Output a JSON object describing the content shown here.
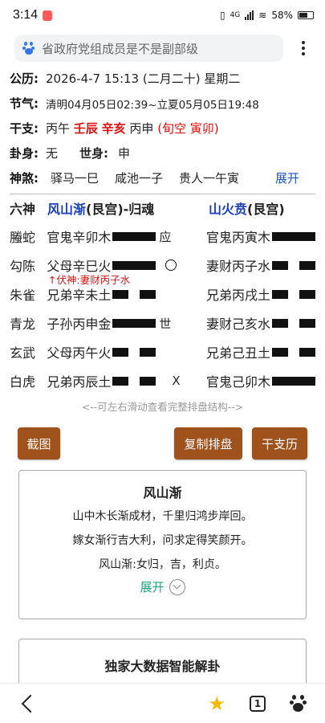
{
  "status": {
    "time": "3:14",
    "signal_label": "4G",
    "battery": "58%"
  },
  "search": {
    "query": "省政府党组成员是不是副部级"
  },
  "info": {
    "gongli_label": "公历:",
    "gongli_value": "2026-4-7 15:13 (二月二十) 星期二",
    "jieqi_label": "节气:",
    "jieqi_value": "清明04月05日02:39~立夏05月05日19:48",
    "ganzhi_label": "干支:",
    "ganzhi_1": "丙午",
    "ganzhi_2": "壬辰",
    "ganzhi_3": "辛亥",
    "ganzhi_4": "丙申",
    "ganzhi_kong": "(旬空 寅卯)",
    "guashen_label": "卦身:",
    "guashen_value": "无",
    "shishen_label": "世身:",
    "shishen_value": "申",
    "shensha_label": "神煞:",
    "shensha_items": [
      "驿马一巳",
      "咸池一子",
      "贵人一午寅"
    ],
    "shensha_expand": "展开"
  },
  "hexagram": {
    "head_god": "六神",
    "main_name": "风山渐",
    "main_palace": "(艮宫)-归魂",
    "changed_name": "山火贲",
    "changed_palace": "(艮宫)",
    "rows": [
      {
        "god": "螣蛇",
        "main": "官鬼辛卯木",
        "main_line": "yang",
        "mark": "应",
        "changed": "官鬼丙寅木",
        "changed_line": "yang"
      },
      {
        "god": "勾陈",
        "main": "父母辛巳火",
        "main_line": "yang",
        "mark": "○",
        "changed": "妻财丙子水",
        "changed_line": "yin",
        "fushen": "↑伏神:妻财丙子水"
      },
      {
        "god": "朱雀",
        "main": "兄弟辛未土",
        "main_line": "yin",
        "mark": "",
        "changed": "兄弟丙戌土",
        "changed_line": "yin"
      },
      {
        "god": "青龙",
        "main": "子孙丙申金",
        "main_line": "yang",
        "mark": "世",
        "changed": "妻财己亥水",
        "changed_line": "yin"
      },
      {
        "god": "玄武",
        "main": "父母丙午火",
        "main_line": "yin",
        "mark": "",
        "changed": "兄弟己丑土",
        "changed_line": "yin"
      },
      {
        "god": "白虎",
        "main": "兄弟丙辰土",
        "main_line": "yin",
        "mark": "X",
        "changed": "官鬼己卯木",
        "changed_line": "yang"
      }
    ],
    "hint": "<--可左右滑动查看完整排盘结构-->"
  },
  "buttons": {
    "screenshot": "截图",
    "copy": "复制排盘",
    "calendar": "干支历"
  },
  "card": {
    "title": "风山渐",
    "lines": [
      "山中木长渐成材，千里归鸿步岸回。",
      "嫁女渐行吉大利，问求定得笑颜开。",
      "风山渐:女归，吉，利贞。"
    ],
    "expand": "展开"
  },
  "card2": {
    "title": "独家大数据智能解卦"
  },
  "nav": {
    "tab_count": "1"
  },
  "colors": {
    "accent_button": "#a0521d",
    "red": "#e01010",
    "blue": "#1a3fbf",
    "teal": "#1aa57a"
  }
}
